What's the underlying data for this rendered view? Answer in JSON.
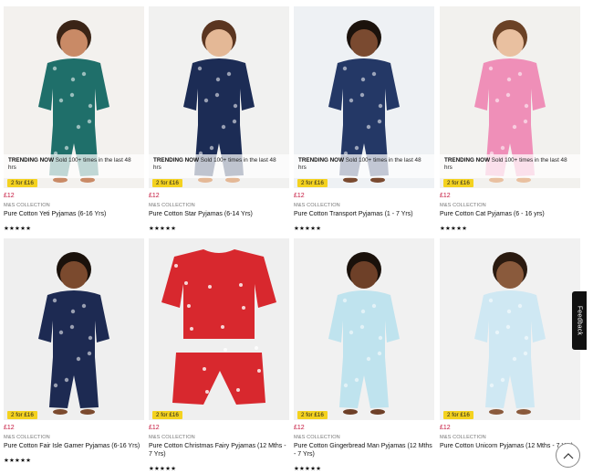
{
  "products": [
    {
      "trend_label": "TRENDING NOW",
      "trend_text": "Sold 100+ times in the last 48 hrs",
      "badge": "2 for £16",
      "price": "£12",
      "brand": "M&S COLLECTION",
      "title": "Pure Cotton Yeti Pyjamas (6-16 Yrs)",
      "stars": "★★★★★",
      "colors": {
        "bg": "#f3f1ee",
        "outfit": "#1f6f6a",
        "skin": "#c98a66",
        "hair": "#3a2416"
      }
    },
    {
      "trend_label": "TRENDING NOW",
      "trend_text": "Sold 100+ times in the last 48 hrs",
      "badge": "2 for £16",
      "price": "£12",
      "brand": "M&S COLLECTION",
      "title": "Pure Cotton Star Pyjamas (6-14 Yrs)",
      "stars": "★★★★★",
      "colors": {
        "bg": "#f1f1f0",
        "outfit": "#1c2c55",
        "skin": "#e4b896",
        "hair": "#5a3520"
      }
    },
    {
      "trend_label": "TRENDING NOW",
      "trend_text": "Sold 100+ times in the last 48 hrs",
      "badge": "2 for £16",
      "price": "£12",
      "brand": "M&S COLLECTION",
      "title": "Pure Cotton Transport Pyjamas (1 - 7 Yrs)",
      "stars": "★★★★★",
      "colors": {
        "bg": "#eef1f4",
        "outfit": "#243866",
        "skin": "#7a4a30",
        "hair": "#1b120c"
      }
    },
    {
      "trend_label": "TRENDING NOW",
      "trend_text": "Sold 100+ times in the last 48 hrs",
      "badge": "2 for £16",
      "price": "£12",
      "brand": "M&S COLLECTION",
      "title": "Pure Cotton Cat Pyjamas (6 - 16 yrs)",
      "stars": "★★★★★",
      "colors": {
        "bg": "#f2f1ee",
        "outfit": "#ef8fb8",
        "skin": "#e9c0a0",
        "hair": "#6b4226"
      }
    },
    {
      "badge": "2 for £16",
      "price": "£12",
      "brand": "M&S COLLECTION",
      "title": "Pure Cotton Fair Isle Gamer Pyjamas (6-16 Yrs)",
      "stars": "★★★★★",
      "colors": {
        "bg": "#efefef",
        "outfit": "#1d2a52",
        "skin": "#7b4a2e",
        "hair": "#1a110b"
      }
    },
    {
      "badge": "2 for £16",
      "price": "£12",
      "brand": "M&S COLLECTION",
      "title": "Pure Cotton Christmas Fairy Pyjamas (12 Mths - 7 Yrs)",
      "stars": "★★★★★",
      "colors": {
        "bg": "#efefef",
        "outfit": "#d8282e",
        "skin": "#ffffff",
        "hair": "#ffffff"
      }
    },
    {
      "badge": "2 for £16",
      "price": "£12",
      "brand": "M&S COLLECTION",
      "title": "Pure Cotton Gingerbread Man Pyjamas (12 Mths - 7 Yrs)",
      "stars": "★★★★★",
      "colors": {
        "bg": "#f1f1f1",
        "outfit": "#bfe3ee",
        "skin": "#6e4028",
        "hair": "#1a110b"
      }
    },
    {
      "badge": "2 for £16",
      "price": "£12",
      "brand": "M&S COLLECTION",
      "title": "Pure Cotton Unicorn Pyjamas (12 Mths - 7 Yrs)",
      "stars": "",
      "colors": {
        "bg": "#f1f1f1",
        "outfit": "#cfe8f3",
        "skin": "#8a5a3c",
        "hair": "#2a1a10"
      }
    }
  ],
  "feedback_label": "Feedback",
  "back_to_top_icon": "chevron-up-icon"
}
